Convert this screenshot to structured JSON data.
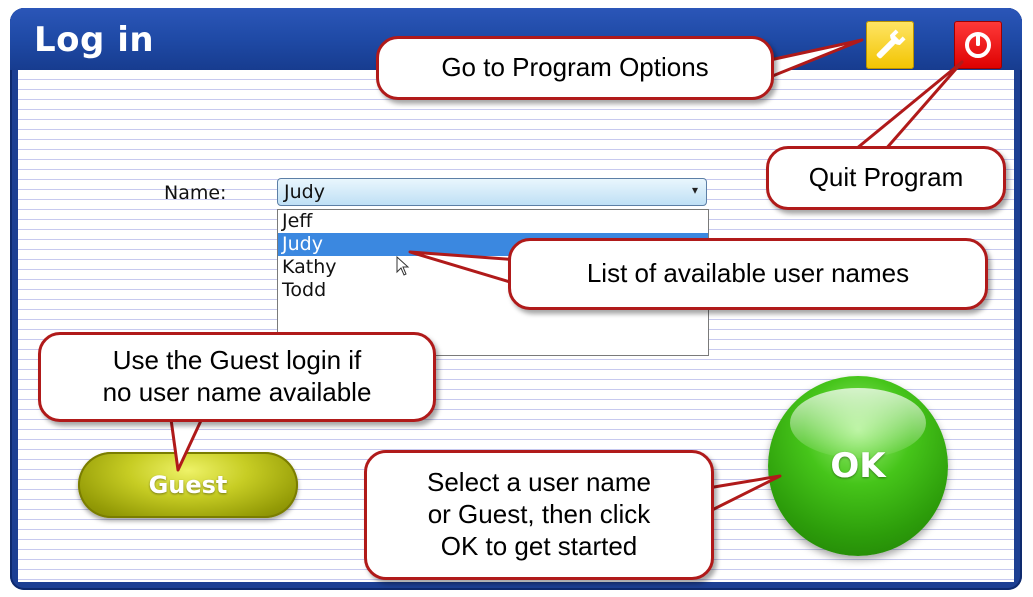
{
  "window": {
    "title": "Log in"
  },
  "toolbar": {
    "options_icon": "wrench-icon",
    "quit_icon": "power-icon"
  },
  "form": {
    "name_label": "Name:",
    "selected_name": "Judy",
    "options": [
      "Jeff",
      "Judy",
      "Kathy",
      "Todd"
    ],
    "highlighted_option": "Judy"
  },
  "buttons": {
    "guest_label": "Guest",
    "ok_label": "OK"
  },
  "callouts": {
    "options": "Go to Program Options",
    "quit": "Quit Program",
    "user_list": "List of available user names",
    "guest_line1": "Use the Guest login if",
    "guest_line2": "no user name available",
    "ok_line1": "Select a user name",
    "ok_line2": "or Guest, then click",
    "ok_line3": "OK to get started"
  },
  "colors": {
    "titlebar": "#1f4aa6",
    "options_button": "#f2c400",
    "quit_button": "#dd0000",
    "selection_highlight": "#3b88e0",
    "guest_button": "#b7bd12",
    "ok_button": "#3fb214",
    "callout_border": "#b01a1a"
  }
}
